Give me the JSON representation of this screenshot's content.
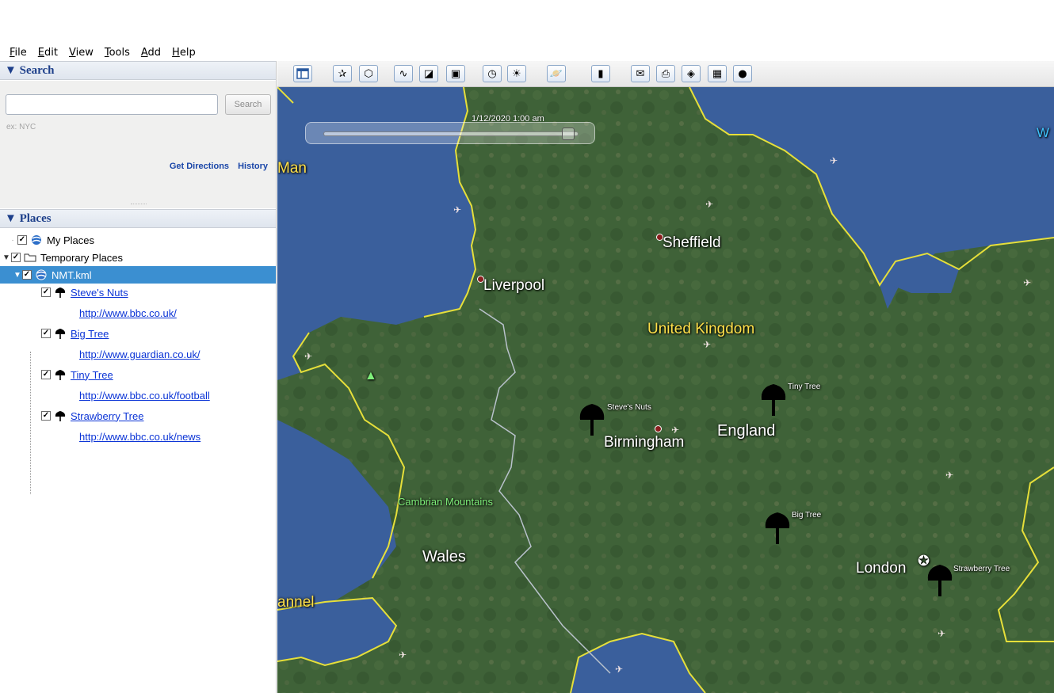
{
  "menu": [
    "File",
    "Edit",
    "View",
    "Tools",
    "Add",
    "Help"
  ],
  "search": {
    "header": "▼ Search",
    "input_value": "",
    "button": "Search",
    "hint": "ex: NYC",
    "get_directions": "Get Directions",
    "history": "History"
  },
  "places": {
    "header": "▼ Places",
    "my_places": "My Places",
    "temporary_places": "Temporary Places",
    "kml": "NMT.kml",
    "items": [
      {
        "name": "Steve's Nuts",
        "url": "http://www.bbc.co.uk/"
      },
      {
        "name": "Big Tree",
        "url": "http://www.guardian.co.uk/"
      },
      {
        "name": "Tiny Tree",
        "url": "http://www.bbc.co.uk/football"
      },
      {
        "name": "Strawberry Tree",
        "url": "http://www.bbc.co.uk/news"
      }
    ]
  },
  "map": {
    "time": "1/12/2020   1:00 am",
    "labels": {
      "man": "Man",
      "sheffield": "Sheffield",
      "liverpool": "Liverpool",
      "united_kingdom": "United Kingdom",
      "england": "England",
      "birmingham": "Birmingham",
      "cambrian": "Cambrian Mountains",
      "wales": "Wales",
      "london": "London",
      "channel": "annel",
      "w": "W"
    },
    "placemarks": {
      "steves_nuts": "Steve's Nuts",
      "tiny_tree": "Tiny Tree",
      "big_tree": "Big Tree",
      "strawberry_tree": "Strawberry Tree"
    }
  },
  "toolbar_icons": [
    "sidebar-toggle-icon",
    "add-placemark-icon",
    "add-polygon-icon",
    "add-path-icon",
    "add-image-overlay-icon",
    "record-tour-icon",
    "historical-imagery-icon",
    "sunlight-icon",
    "switch-planet-icon",
    "ruler-icon",
    "email-icon",
    "print-icon",
    "view-in-maps-icon",
    "save-image-icon",
    "earth-gallery-icon"
  ]
}
